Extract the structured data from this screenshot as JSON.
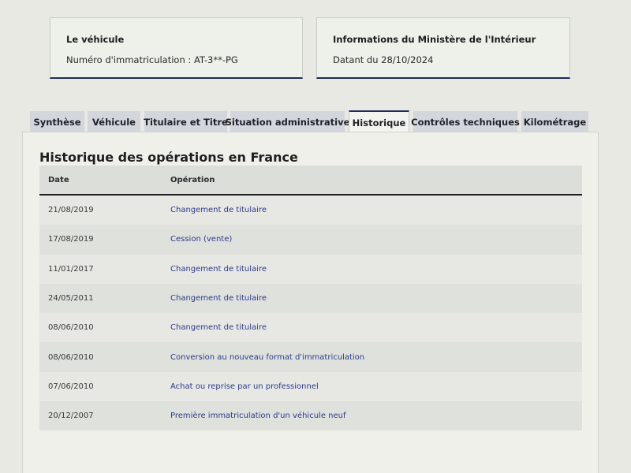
{
  "cards": {
    "vehicle": {
      "title": "Le véhicule",
      "line": "Numéro d'immatriculation : AT-3**-PG"
    },
    "ministry": {
      "title": "Informations du Ministère de l'Intérieur",
      "line": "Datant du 28/10/2024"
    }
  },
  "tabs": [
    {
      "label": "Synthèse",
      "active": false
    },
    {
      "label": "Véhicule",
      "active": false
    },
    {
      "label": "Titulaire et Titre",
      "active": false
    },
    {
      "label": "Situation administrative",
      "active": false
    },
    {
      "label": "Historique",
      "active": true
    },
    {
      "label": "Contrôles techniques",
      "active": false
    },
    {
      "label": "Kilométrage",
      "active": false
    }
  ],
  "panel": {
    "title": "Historique des opérations en France",
    "columns": {
      "date": "Date",
      "operation": "Opération"
    },
    "rows": [
      {
        "date": "21/08/2019",
        "operation": "Changement de titulaire"
      },
      {
        "date": "17/08/2019",
        "operation": "Cession (vente)"
      },
      {
        "date": "11/01/2017",
        "operation": "Changement de titulaire"
      },
      {
        "date": "24/05/2011",
        "operation": "Changement de titulaire"
      },
      {
        "date": "08/06/2010",
        "operation": "Changement de titulaire"
      },
      {
        "date": "08/06/2010",
        "operation": "Conversion au nouveau format d'immatriculation"
      },
      {
        "date": "07/06/2010",
        "operation": "Achat ou reprise par un professionnel"
      },
      {
        "date": "20/12/2007",
        "operation": "Première immatriculation d'un véhicule neuf"
      }
    ]
  },
  "colors": {
    "accent": "#1f2a5c",
    "link": "#2d3a8c",
    "tab_bg": "#d3d6dc",
    "page_bg": "#e8e9e3"
  }
}
